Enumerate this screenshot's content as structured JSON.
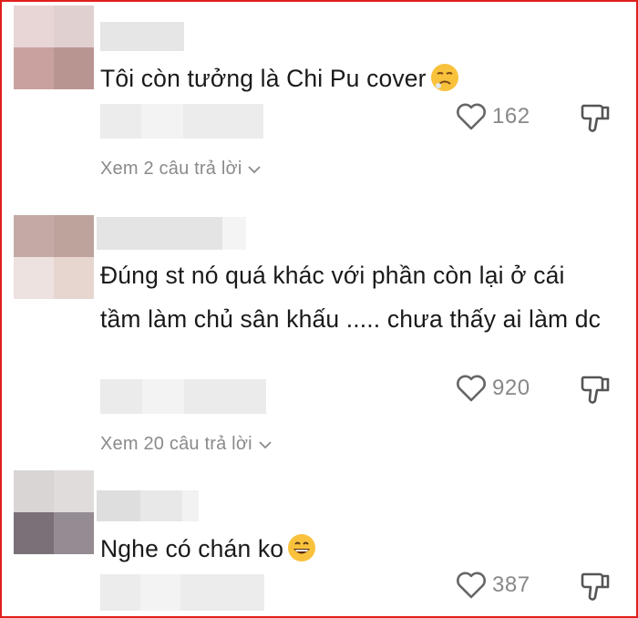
{
  "comments": [
    {
      "text": "Tôi còn tưởng là Chi Pu cover",
      "emoji": "tired-face-emoji",
      "likes": "162",
      "replies": "Xem 2 câu trả lời"
    },
    {
      "text": "Đúng st nó quá khác với phần còn lại ở cái tầm làm chủ sân khấu ..... chưa thấy ai làm dc",
      "emoji": "",
      "likes": "920",
      "replies": "Xem 20 câu trả lời"
    },
    {
      "text": "Nghe có chán ko",
      "emoji": "grinning-face-emoji",
      "likes": "387",
      "replies": ""
    }
  ],
  "icons": {
    "like": "heart-icon",
    "dislike": "thumbs-down-icon",
    "view_replies": "chevron-down-icon"
  },
  "colors": {
    "border": "#e0201b",
    "text": "#1a1a1a",
    "muted": "#8a8a8a"
  }
}
